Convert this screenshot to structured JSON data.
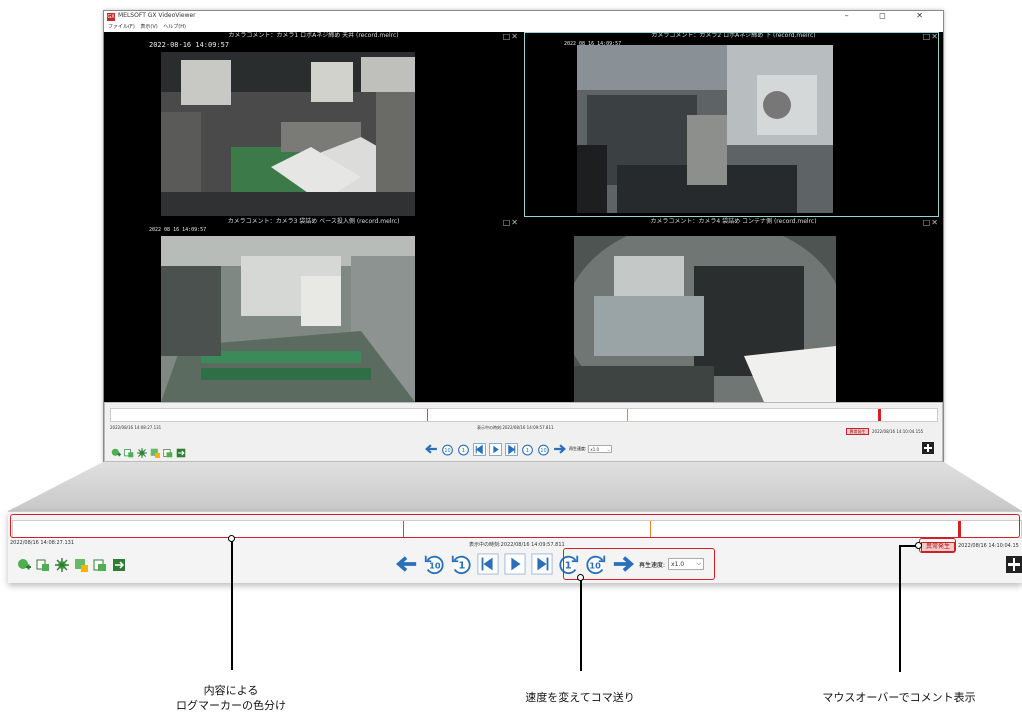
{
  "app": {
    "title": "MELSOFT GX VideoViewer",
    "icon_text": "GX",
    "window_controls": "–  ◻  ✕",
    "menu": [
      "ファイル(F)",
      "表示(V)",
      "ヘルプ(H)"
    ]
  },
  "panels": [
    {
      "comment": "カメラコメント：カメラ1 ロボAネジ締め 天井 (record.melrc)",
      "timestamp": "2022-08-16  14:09:57",
      "active": false
    },
    {
      "comment": "カメラコメント：カメラ2 ロボAネジ締め 下 (record.melrc)",
      "timestamp": "2022 08 16  14:09:57",
      "active": true
    },
    {
      "comment": "カメラコメント：カメラ3 袋詰め ベース投入側 (record.melrc)",
      "timestamp": "2022 08 16  14:09:57",
      "active": false
    },
    {
      "comment": "カメラコメント：カメラ4 袋詰め コンテナ側 (record.melrc)",
      "timestamp": "",
      "active": false
    }
  ],
  "panel_buttons": "□✕",
  "controls": {
    "start_time": "2022/08/16  14:08:27.131",
    "current_label": "表示中の時刻:2022/08/16  14:09:57.811",
    "end_time": "2022/08/16  14:10:04.155",
    "end_time_cut": "2022/08/16  14:10:04.15",
    "speed_label": "再生速度:",
    "speed_value": "x1.0",
    "speed_arrow": "⌵",
    "marker_label": "異常発生",
    "step_10": "10",
    "step_1": "1"
  },
  "log_marker_colors": {
    "green": "#2e9e3e",
    "orange": "#e8872a",
    "red": "#d42020"
  },
  "annotations": {
    "timeline": "内容による\nログマーカーの色分け",
    "speed": "速度を変えてコマ送り",
    "marker": "マウスオーバーでコメント表示"
  },
  "icons": [
    "log-add-icon",
    "capture-icon",
    "settings-icon",
    "marker-edit-icon",
    "export-icon",
    "sync-icon"
  ]
}
